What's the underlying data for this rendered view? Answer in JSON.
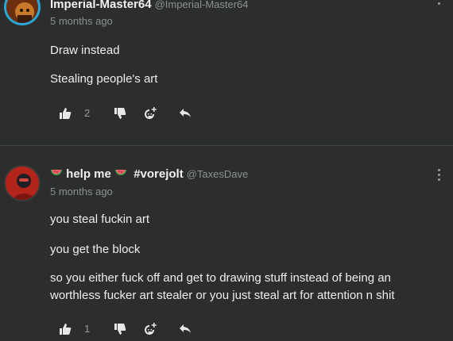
{
  "comments": [
    {
      "author": "Imperial-Master64",
      "handle": "@Imperial-Master64",
      "time": "5 months ago",
      "lines": [
        "Draw instead",
        "Stealing people's art"
      ],
      "likes": "2"
    },
    {
      "author_prefix": "help me",
      "author_suffix": "#vorejolt",
      "handle": "@TaxesDave",
      "time": "5 months ago",
      "lines": [
        "you steal fuckin art",
        "you get the block",
        "so you either fuck off and get to drawing stuff instead of being an",
        "worthless fucker art stealer or you just steal art for attention n shit"
      ],
      "likes": "1"
    }
  ],
  "icons": [
    "like-icon",
    "dislike-icon",
    "sticker-icon",
    "reply-icon",
    "more-options-icon",
    "watermelon-icon"
  ],
  "colors": {
    "background": "#2b2e2c",
    "avatar_ring": "#2aa7d8",
    "muted_text": "#8d9190"
  }
}
